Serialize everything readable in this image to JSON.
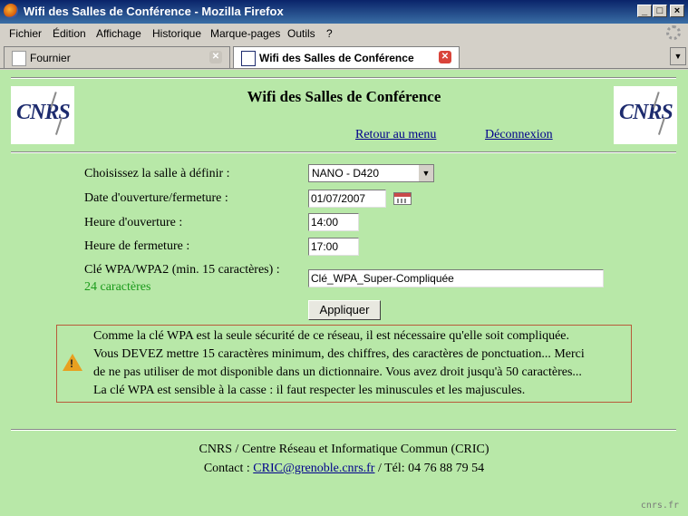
{
  "window": {
    "title": "Wifi des Salles de Conférence - Mozilla Firefox"
  },
  "menu": [
    "Fichier",
    "Édition",
    "Affichage",
    "Historique",
    "Marque-pages",
    "Outils",
    "?"
  ],
  "tabs": [
    {
      "label": "Fournier",
      "active": false
    },
    {
      "label": "Wifi des Salles de Conférence",
      "active": true
    }
  ],
  "header": {
    "title": "Wifi des Salles de Conférence",
    "logo_text": "CNRS",
    "links": {
      "menu": "Retour au menu",
      "logout": "Déconnexion"
    }
  },
  "form": {
    "room_label": "Choisissez la salle à définir :",
    "room_value": "NANO - D420",
    "date_label": "Date d'ouverture/fermeture :",
    "date_value": "01/07/2007",
    "open_label": "Heure d'ouverture :",
    "open_value": "14:00",
    "close_label": "Heure de fermeture :",
    "close_value": "17:00",
    "key_label": "Clé WPA/WPA2 (min. 15 caractères) :",
    "key_count": "24 caractères",
    "key_value": "Clé_WPA_Super-Compliquée",
    "apply_label": "Appliquer"
  },
  "warning": {
    "lines": [
      "Comme la clé WPA est la seule sécurité de ce réseau, il est nécessaire qu'elle soit compliquée.",
      "Vous DEVEZ mettre 15 caractères minimum, des chiffres, des caractères de ponctuation... Merci",
      "de ne pas utiliser de mot disponible dans un dictionnaire. Vous avez droit jusqu'à 50 caractères...",
      "La clé WPA est sensible à la casse : il faut respecter les minuscules et les majuscules."
    ]
  },
  "footer": {
    "org": "CNRS / Centre Réseau et Informatique Commun (CRIC)",
    "contact_prefix": "Contact : ",
    "email": "CRIC@grenoble.cnrs.fr",
    "phone": " / Tél: 04 76 88 79 54"
  },
  "watermark": "cnrs.fr",
  "colors": {
    "page_bg": "#b8e8a8",
    "link": "#00008b",
    "count_green": "#1a9a1a",
    "warn_border": "#b85b3a"
  }
}
